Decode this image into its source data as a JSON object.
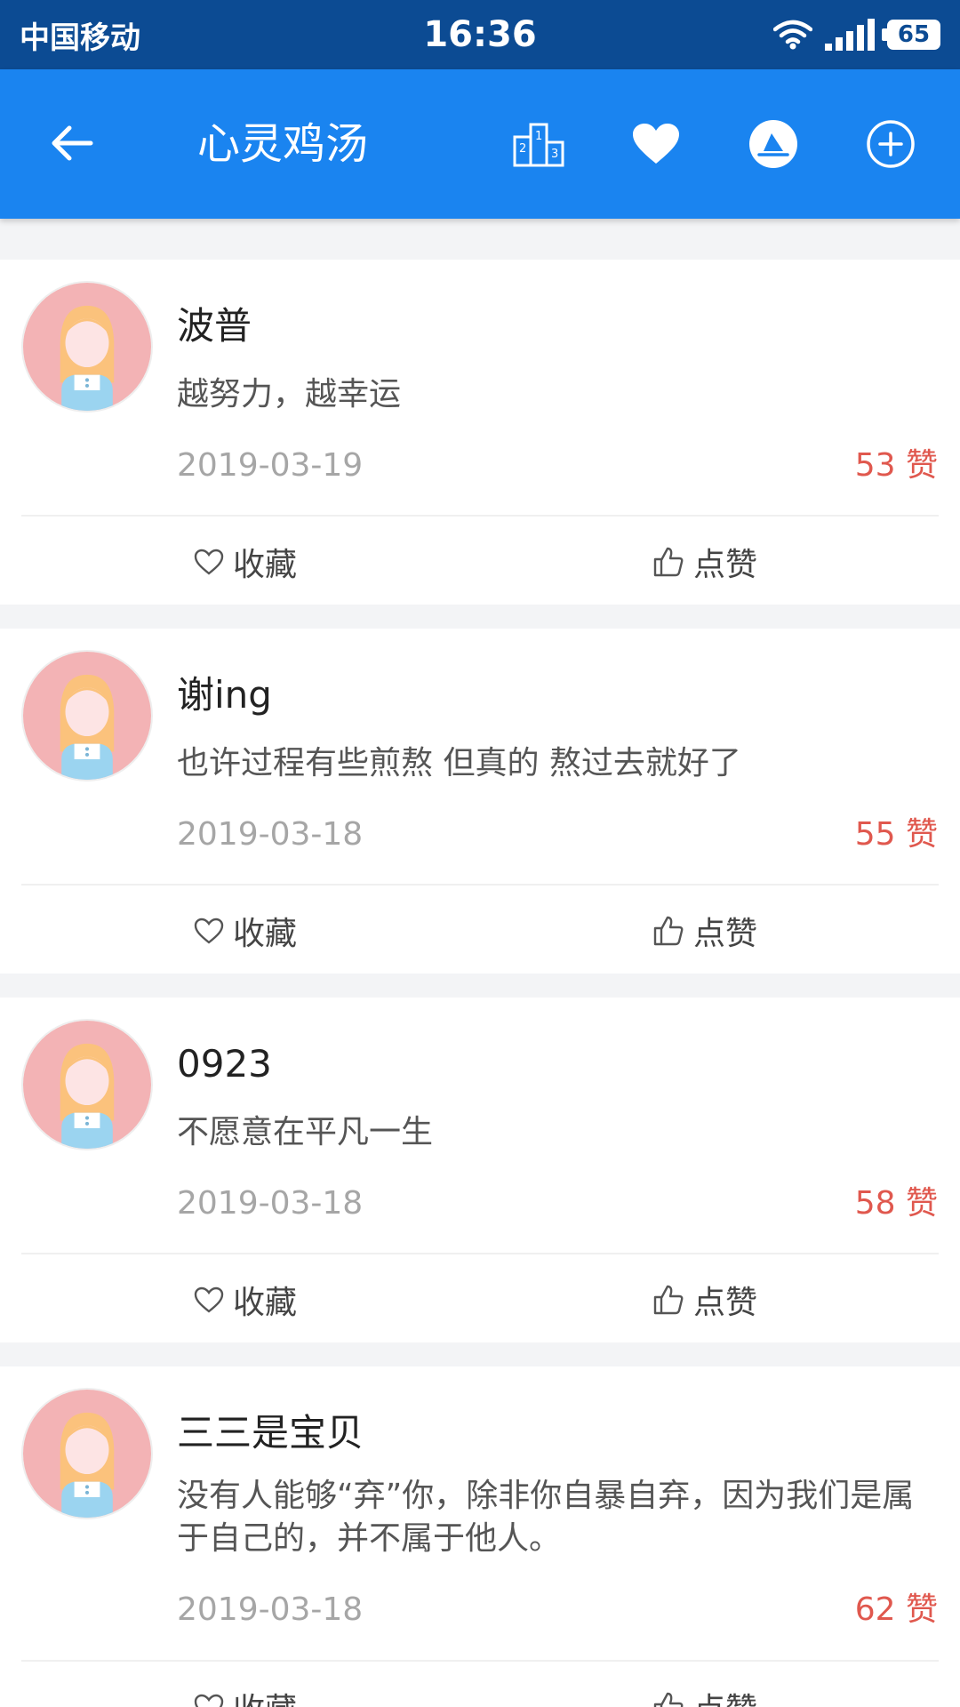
{
  "status_bar": {
    "carrier": "中国移动",
    "time": "16:36",
    "battery": "65"
  },
  "app_bar": {
    "title": "心灵鸡汤",
    "icons": [
      "back-arrow-icon",
      "ranking-podium-icon",
      "heart-icon",
      "paper-boat-icon",
      "add-circle-icon"
    ]
  },
  "actions": {
    "favorite_label": "收藏",
    "like_label": "点赞"
  },
  "posts": [
    {
      "user": "波普",
      "content": "越努力，越幸运",
      "date": "2019-03-19",
      "likes": "53 赞"
    },
    {
      "user": "谢ing",
      "content": "也许过程有些煎熬 但真的 熬过去就好了",
      "date": "2019-03-18",
      "likes": "55 赞"
    },
    {
      "user": "0923",
      "content": "不愿意在平凡一生",
      "date": "2019-03-18",
      "likes": "58 赞"
    },
    {
      "user": "三三是宝贝",
      "content": "没有人能够“弃”你，除非你自暴自弃，因为我们是属于自己的，并不属于他人。",
      "date": "2019-03-18",
      "likes": "62 赞"
    }
  ],
  "colors": {
    "status_bar": "#0c4b93",
    "app_bar": "#1a84f0",
    "likes_text": "#e0584e",
    "background": "#f3f4f6"
  }
}
